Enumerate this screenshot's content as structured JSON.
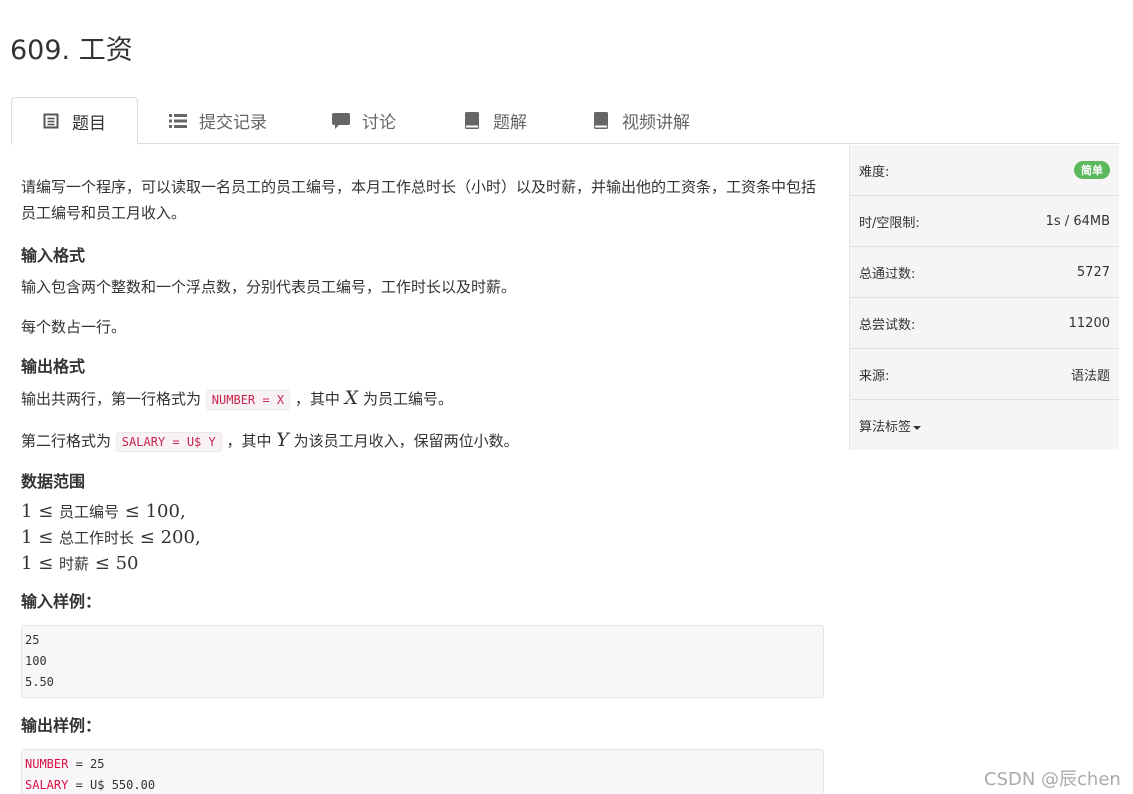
{
  "page": {
    "title": "609. 工资"
  },
  "tabs": [
    {
      "label": "题目",
      "icon": "file-text-icon",
      "active": true
    },
    {
      "label": "提交记录",
      "icon": "list-icon"
    },
    {
      "label": "讨论",
      "icon": "comment-icon"
    },
    {
      "label": "题解",
      "icon": "book-icon"
    },
    {
      "label": "视频讲解",
      "icon": "book-icon"
    }
  ],
  "problem": {
    "description": "请编写一个程序，可以读取一名员工的员工编号，本月工作总时长（小时）以及时薪，并输出他的工资条，工资条中包括员工编号和员工月收入。",
    "input_heading": "输入格式",
    "input_p1": "输入包含两个整数和一个浮点数，分别代表员工编号，工作时长以及时薪。",
    "input_p2": "每个数占一行。",
    "output_heading": "输出格式",
    "output_p1_pre": "输出共两行，第一行格式为",
    "output_p1_code": "NUMBER = X",
    "output_p1_mid": "，其中",
    "output_p1_var": "X",
    "output_p1_post": "为员工编号。",
    "output_p2_pre": "第二行格式为",
    "output_p2_code": "SALARY = U$ Y",
    "output_p2_mid": "，其中",
    "output_p2_var": "Y",
    "output_p2_post": "为该员工月收入，保留两位小数。",
    "range_heading": "数据范围",
    "ranges": [
      {
        "low": "1",
        "le1": "≤",
        "name": "员工编号",
        "le2": "≤",
        "high": "100",
        "end": ","
      },
      {
        "low": "1",
        "le1": "≤",
        "name": "总工作时长",
        "le2": "≤",
        "high": "200",
        "end": ","
      },
      {
        "low": "1",
        "le1": "≤",
        "name": "时薪",
        "le2": "≤",
        "high": "50",
        "end": ""
      }
    ],
    "sample_input_heading": "输入样例：",
    "sample_input": [
      "25",
      "100",
      "5.50"
    ],
    "sample_output_heading": "输出样例：",
    "sample_output": [
      {
        "key": "NUMBER",
        "rest": " = 25"
      },
      {
        "key": "SALARY",
        "rest": " = U$ 550.00"
      }
    ]
  },
  "sidebar": {
    "difficulty_label": "难度:",
    "difficulty_value": "简单",
    "limit_label": "时/空限制:",
    "limit_value": "1s / 64MB",
    "passed_label": "总通过数:",
    "passed_value": "5727",
    "attempts_label": "总尝试数:",
    "attempts_value": "11200",
    "source_label": "来源:",
    "source_value": "语法题",
    "tags_label": "算法标签"
  },
  "watermark": "CSDN @辰chen",
  "colors": {
    "badge": "#5cb85c",
    "code_red": "#dd1144"
  }
}
